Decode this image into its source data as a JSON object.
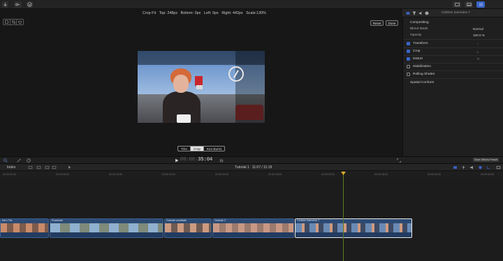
{
  "viewer": {
    "crop_info": {
      "mode": "Crop Fit",
      "top": "Top: 248px",
      "bottom": "Bottom: 0px",
      "left": "Left: 0px",
      "right": "Right: 442px",
      "scale": "Scale:130%"
    },
    "reset_label": "Reset",
    "done_label": "Done",
    "mode_tabs": [
      "Trim",
      "Crop",
      "Ken Burns"
    ],
    "active_mode": "Crop"
  },
  "inspector": {
    "title": "Clothes Interview 7",
    "compositing": "Compositing",
    "blend_mode_label": "Blend Mode",
    "blend_mode_value": "Normal",
    "opacity_label": "Opacity",
    "opacity_value": "100.0 %",
    "transform": "Transform",
    "crop": "Crop",
    "distort": "Distort",
    "stabilization": "Stabilization",
    "rolling_shutter": "Rolling Shutter",
    "spatial_conform": "Spatial Conform"
  },
  "midbar": {
    "timecode_dim": "00:00:",
    "timecode_main": "35:04",
    "save_preset": "Save Effects Preset"
  },
  "timeline": {
    "index_label": "Index",
    "title": "Tutorial 1",
    "duration": "11:07 / 11:19",
    "ruler_ticks": [
      "00:00:00:00",
      "00:00:05:00",
      "00:00:10:00",
      "00:00:15:00",
      "00:00:20:00",
      "00:00:25:00",
      "00:00:30:00",
      "00:00:35:00",
      "00:00:40:00",
      "00:00:45:00"
    ],
    "clips": [
      {
        "label": "Intro Tile"
      },
      {
        "label": "Roadside"
      },
      {
        "label": "Outside smalltalk"
      },
      {
        "label": "Outside 2"
      },
      {
        "label": "Clothes Interview 7"
      }
    ]
  },
  "colors": {
    "accent": "#3a64c8",
    "playhead": "#d9a92b",
    "clip": "#2c4a73"
  }
}
